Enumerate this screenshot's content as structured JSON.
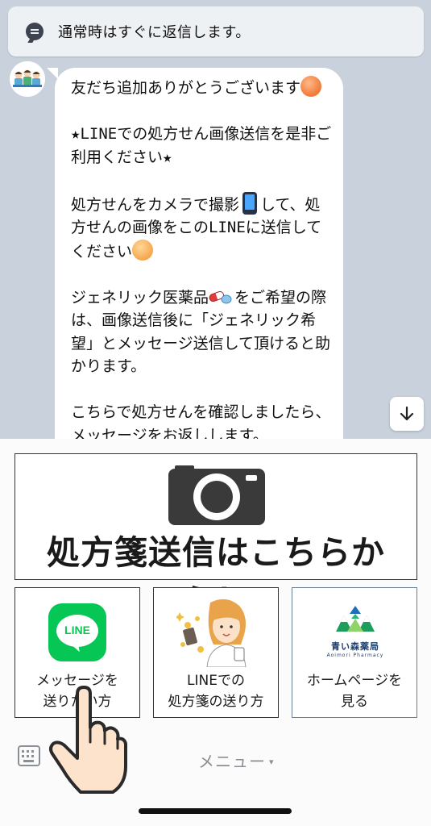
{
  "notice": {
    "text": "通常時はすぐに返信します。",
    "icon": "chat-bubble-icon"
  },
  "message": {
    "paragraphs": [
      {
        "text": "友だち追加ありがとうございます",
        "emoji_after": "grinning-face"
      },
      {
        "text": "★LINEでの処方せん画像送信を是非ご利用ください★"
      },
      {
        "part1": "処方せんをカメラで撮影",
        "emoji_mid": "mobile-phone",
        "part2": "して、処方せんの画像をこのLINEに送信してください",
        "emoji_after": "smiling-face"
      },
      {
        "part1": "ジェネリック医薬品",
        "emoji_mid": "pill",
        "part2": "をご希望の際は、画像送信後に「ジェネリック希望」とメッセージ送信して頂けると助かります。"
      },
      {
        "text": "こちらで処方せんを確認しましたら、メッセージをお返しします。"
      }
    ]
  },
  "rich_menu": {
    "main_button": {
      "label": "処方箋送信はこちらから！",
      "icon": "camera-icon"
    },
    "buttons": [
      {
        "label": "メッセージを\n送りたい方",
        "icon": "line-logo-icon",
        "logo_text": "LINE"
      },
      {
        "label": "LINEでの\n処方箋の送り方",
        "icon": "pharmacist-illustration"
      },
      {
        "label": "ホームページを\n見る",
        "icon": "aoimori-logo",
        "logo_name": "青い森薬局",
        "logo_sub": "Aoimori Pharmacy"
      }
    ]
  },
  "bottom_bar": {
    "menu_label": "メニュー",
    "caret": "▾",
    "keyboard_icon": "keyboard-icon"
  },
  "colors": {
    "chat_bg": "#c9d2dc",
    "line_green": "#06c755",
    "camera": "#3a3a3a"
  }
}
